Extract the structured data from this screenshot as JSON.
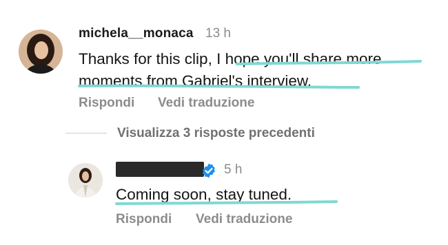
{
  "comment": {
    "username": "michela__monaca",
    "time": "13 h",
    "text_line1": "Thanks for this clip, I hope you'll share more",
    "text_line2": "moments from Gabriel's interview.",
    "actions": {
      "reply": "Rispondi",
      "translate": "Vedi traduzione"
    }
  },
  "view_replies": "Visualizza 3 risposte precedenti",
  "reply": {
    "username": "",
    "verified_icon": "verified-badge-icon",
    "time": "5 h",
    "text": "Coming soon, stay tuned.",
    "actions": {
      "reply": "Rispondi",
      "translate": "Vedi traduzione"
    }
  },
  "colors": {
    "highlight": "#7fd8d2",
    "verified": "#1e90ef",
    "muted": "#8c8c8c"
  }
}
